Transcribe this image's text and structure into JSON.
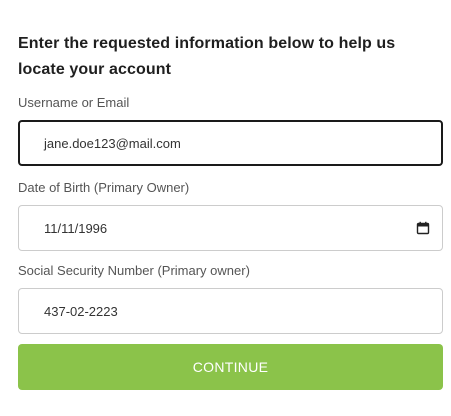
{
  "heading": "Enter the requested information below to help us locate your account",
  "fields": {
    "username": {
      "label": "Username or Email",
      "value": "jane.doe123@mail.com"
    },
    "dob": {
      "label": "Date of Birth (Primary Owner)",
      "value": "11/11/1996",
      "icon": "calendar-icon"
    },
    "ssn": {
      "label": "Social Security Number (Primary owner)",
      "value": "437-02-2223"
    }
  },
  "button": {
    "label": "CONTINUE",
    "color": "#8bc34a"
  },
  "colors": {
    "focused_border": "#1a1a1a",
    "border": "#cccccc"
  }
}
